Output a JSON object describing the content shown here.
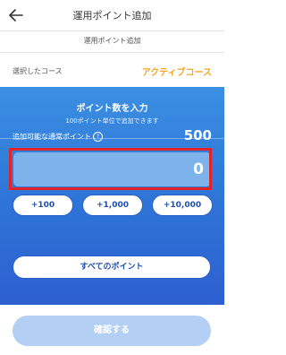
{
  "header": {
    "title": "運用ポイント追加"
  },
  "subtitle": "運用ポイント追加",
  "course": {
    "label": "選択したコース",
    "value": "アクティブコース"
  },
  "panel": {
    "title": "ポイント数を入力",
    "note": "100ポイント単位で追加できます",
    "available_label": "追加可能な通常ポイント",
    "help_icon": "?",
    "available_value": "500",
    "input_value": "0",
    "quick_buttons": [
      "+100",
      "+1,000",
      "+10,000"
    ],
    "all_points_label": "すべてのポイント"
  },
  "confirm_label": "確認する",
  "colors": {
    "accent_orange": "#f5a623",
    "panel_blue": "#2f78d8",
    "highlight_red": "#e0242a",
    "confirm_disabled": "#b3d0f4"
  },
  "icons": {
    "back": "arrow-left-icon",
    "help": "help-circle-icon"
  }
}
